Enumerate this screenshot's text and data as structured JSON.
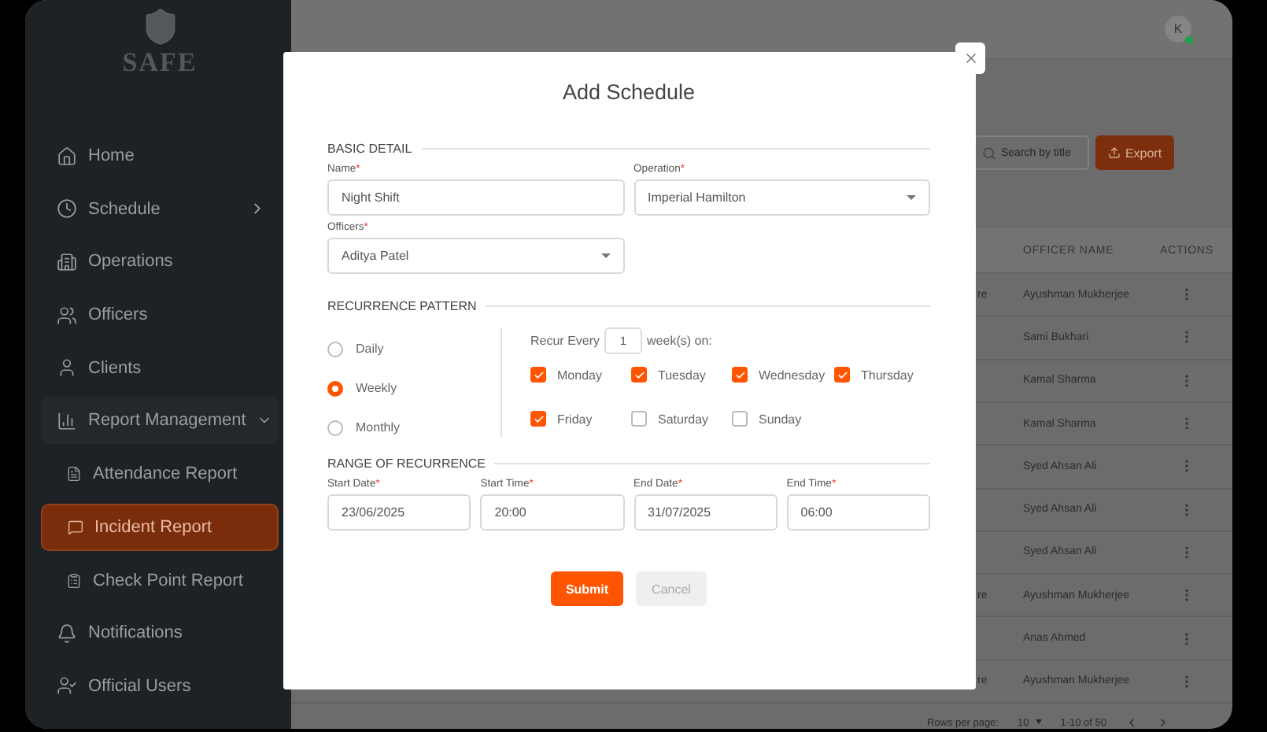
{
  "sidebar": {
    "logo": {
      "text": "SAFE"
    },
    "items": [
      {
        "label": "Home",
        "selected": false
      },
      {
        "label": "Schedule",
        "selected": false,
        "expanded": false
      },
      {
        "label": "Operations",
        "selected": false
      },
      {
        "label": "Officers",
        "selected": false
      },
      {
        "label": "Clients",
        "selected": false
      },
      {
        "label": "Report Management",
        "selected": false,
        "expanded": true,
        "children": [
          {
            "label": "Attendance Report",
            "selected": false
          },
          {
            "label": "Incident Report",
            "selected": true
          },
          {
            "label": "Check Point Report",
            "selected": false
          }
        ]
      },
      {
        "label": "Notifications",
        "selected": false
      },
      {
        "label": "Official Users",
        "selected": false
      }
    ]
  },
  "header": {
    "avatar": "K",
    "online": true
  },
  "toolbar": {
    "search": {
      "placeholder": "Search by title"
    },
    "export": "Export"
  },
  "table": {
    "columns": [
      "OFFICER NAME",
      "ACTIONS"
    ],
    "rows": [
      {
        "column_1": "re",
        "officer": "Ayushman Mukherjee"
      },
      {
        "officer": "Sami Bukhari"
      },
      {
        "officer": "Kamal Sharma"
      },
      {
        "officer": "Kamal Sharma"
      },
      {
        "officer": "Syed Ahsan Ali"
      },
      {
        "officer": "Syed Ahsan Ali"
      },
      {
        "officer": "Syed Ahsan Ali"
      },
      {
        "column_1": "re",
        "officer": "Ayushman Mukherjee"
      },
      {
        "officer": "Anas Ahmed"
      },
      {
        "column_1": "re",
        "officer": "Ayushman Mukherjee"
      }
    ]
  },
  "pagination": {
    "rows_per_page_label": "Rows per page:",
    "rows_per_page": "10",
    "range": "1-10 of 50"
  },
  "modal": {
    "title": "Add Schedule",
    "basic": {
      "heading": "BASIC DETAIL",
      "fields": [
        {
          "label": "Name",
          "mark": "*",
          "value": "Night Shift",
          "kind": "text"
        },
        {
          "label": "Operation",
          "mark": "*",
          "value": "Imperial Hamilton",
          "kind": "select"
        },
        {
          "label": "Officers",
          "mark": "*",
          "value": "Aditya Patel",
          "kind": "select"
        }
      ]
    },
    "recurrence": {
      "heading": "RECURRENCE PATTERN",
      "options": [
        {
          "label": "Daily",
          "selected": false
        },
        {
          "label": "Weekly",
          "selected": true
        },
        {
          "label": "Monthly",
          "selected": false
        }
      ],
      "recur_label": "Recur Every",
      "recur_value": "1",
      "recur_suffix": "week(s) on:",
      "days": [
        {
          "label": "Monday",
          "checked": true
        },
        {
          "label": "Tuesday",
          "checked": true
        },
        {
          "label": "Wednesday",
          "checked": true
        },
        {
          "label": "Thursday",
          "checked": true
        },
        {
          "label": "Friday",
          "checked": true
        },
        {
          "label": "Saturday",
          "checked": false
        },
        {
          "label": "Sunday",
          "checked": false
        }
      ]
    },
    "range": {
      "heading": "RANGE OF RECURRENCE",
      "fields": [
        {
          "label": "Start Date",
          "mark": "*",
          "value": "23/06/2025"
        },
        {
          "label": "Start Time",
          "mark": "*",
          "value": "20:00"
        },
        {
          "label": "End Date",
          "mark": "*",
          "value": "31/07/2025"
        },
        {
          "label": "End Time",
          "mark": "*",
          "value": "06:00"
        }
      ]
    },
    "submit": "Submit",
    "cancel": {
      "label": "Cancel",
      "disabled": true
    }
  }
}
